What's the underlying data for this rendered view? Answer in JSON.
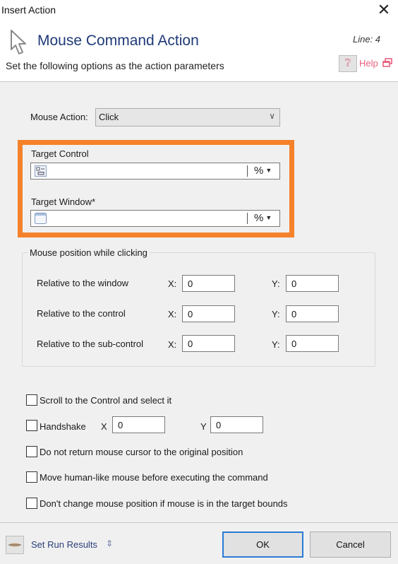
{
  "window": {
    "title": "Insert Action",
    "close_icon": "close-icon"
  },
  "header": {
    "icon": "mouse-cursor-icon",
    "title": "Mouse Command Action",
    "line_label": "Line: 4",
    "subtitle": "Set the following options as the action parameters",
    "help_icon": "help-icon",
    "help_label": "Help",
    "help_popout_icon": "popout-icon"
  },
  "mouse_action": {
    "label": "Mouse Action:",
    "value": "Click"
  },
  "target": {
    "highlight_color": "#f5822a",
    "control_label": "Target Control",
    "control_value": "",
    "control_icon": "control-icon",
    "window_label": "Target Window*",
    "window_value": "",
    "window_icon": "window-icon",
    "variable_button": "%"
  },
  "position_group": {
    "title": "Mouse position while clicking",
    "rows": [
      {
        "label": "Relative to the window",
        "x_label": "X:",
        "x": "0",
        "y_label": "Y:",
        "y": "0"
      },
      {
        "label": "Relative to the control",
        "x_label": "X:",
        "x": "0",
        "y_label": "Y:",
        "y": "0"
      },
      {
        "label": "Relative to the sub-control",
        "x_label": "X:",
        "x": "0",
        "y_label": "Y:",
        "y": "0"
      }
    ]
  },
  "options": {
    "scroll": {
      "label": "Scroll to the Control and select it",
      "checked": false
    },
    "handshake": {
      "label": "Handshake",
      "checked": false,
      "x_label": "X",
      "x": "0",
      "y_label": "Y",
      "y": "0"
    },
    "no_return": {
      "label": "Do not return mouse cursor to the original position",
      "checked": false
    },
    "human_like": {
      "label": "Move human-like mouse before executing the command",
      "checked": false
    },
    "no_change": {
      "label": "Don't change mouse position if mouse is in the target bounds",
      "checked": false
    }
  },
  "footer": {
    "run_results_label": "Set Run Results",
    "run_results_icon": "run-results-icon",
    "expand_icon": "expand-icon",
    "ok_label": "OK",
    "cancel_label": "Cancel"
  }
}
